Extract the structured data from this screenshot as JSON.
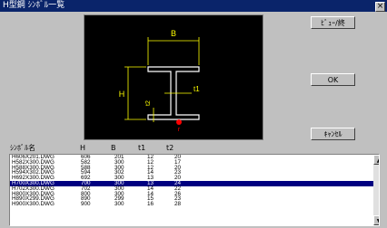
{
  "window": {
    "title": "H型鋼 ｼﾝﾎﾞﾙ一覧",
    "close_label": "×"
  },
  "preview": {
    "labels": {
      "B": "B",
      "H": "H",
      "t1": "t1",
      "t2": "t2",
      "r": "r"
    },
    "colors": {
      "background": "#000000",
      "section": "#ffffff",
      "dimension": "#ffff00",
      "marker": "#ff0000"
    }
  },
  "buttons": {
    "view": "ﾋﾞｭｰ/終",
    "ok": "OK",
    "cancel": "ｷｬﾝｾﾙ"
  },
  "list": {
    "headers": [
      "ｼﾝﾎﾞﾙ名",
      "H",
      "B",
      "t1",
      "t2"
    ],
    "selected_index": 5,
    "rows": [
      [
        "H606X201.DWG",
        "606",
        "201",
        "12",
        "20"
      ],
      [
        "H582X300.DWG",
        "582",
        "300",
        "12",
        "17"
      ],
      [
        "H588X300.DWG",
        "588",
        "300",
        "12",
        "20"
      ],
      [
        "H594X302.DWG",
        "594",
        "302",
        "14",
        "23"
      ],
      [
        "H692X300.DWG",
        "692",
        "300",
        "13",
        "20"
      ],
      [
        "H700X300.DWG",
        "700",
        "300",
        "13",
        "24"
      ],
      [
        "H702X300.DWG",
        "702",
        "300",
        "14",
        "22"
      ],
      [
        "H800X300.DWG",
        "800",
        "300",
        "14",
        "26"
      ],
      [
        "H890X299.DWG",
        "890",
        "299",
        "15",
        "23"
      ],
      [
        "H900X300.DWG",
        "900",
        "300",
        "16",
        "28"
      ]
    ]
  }
}
